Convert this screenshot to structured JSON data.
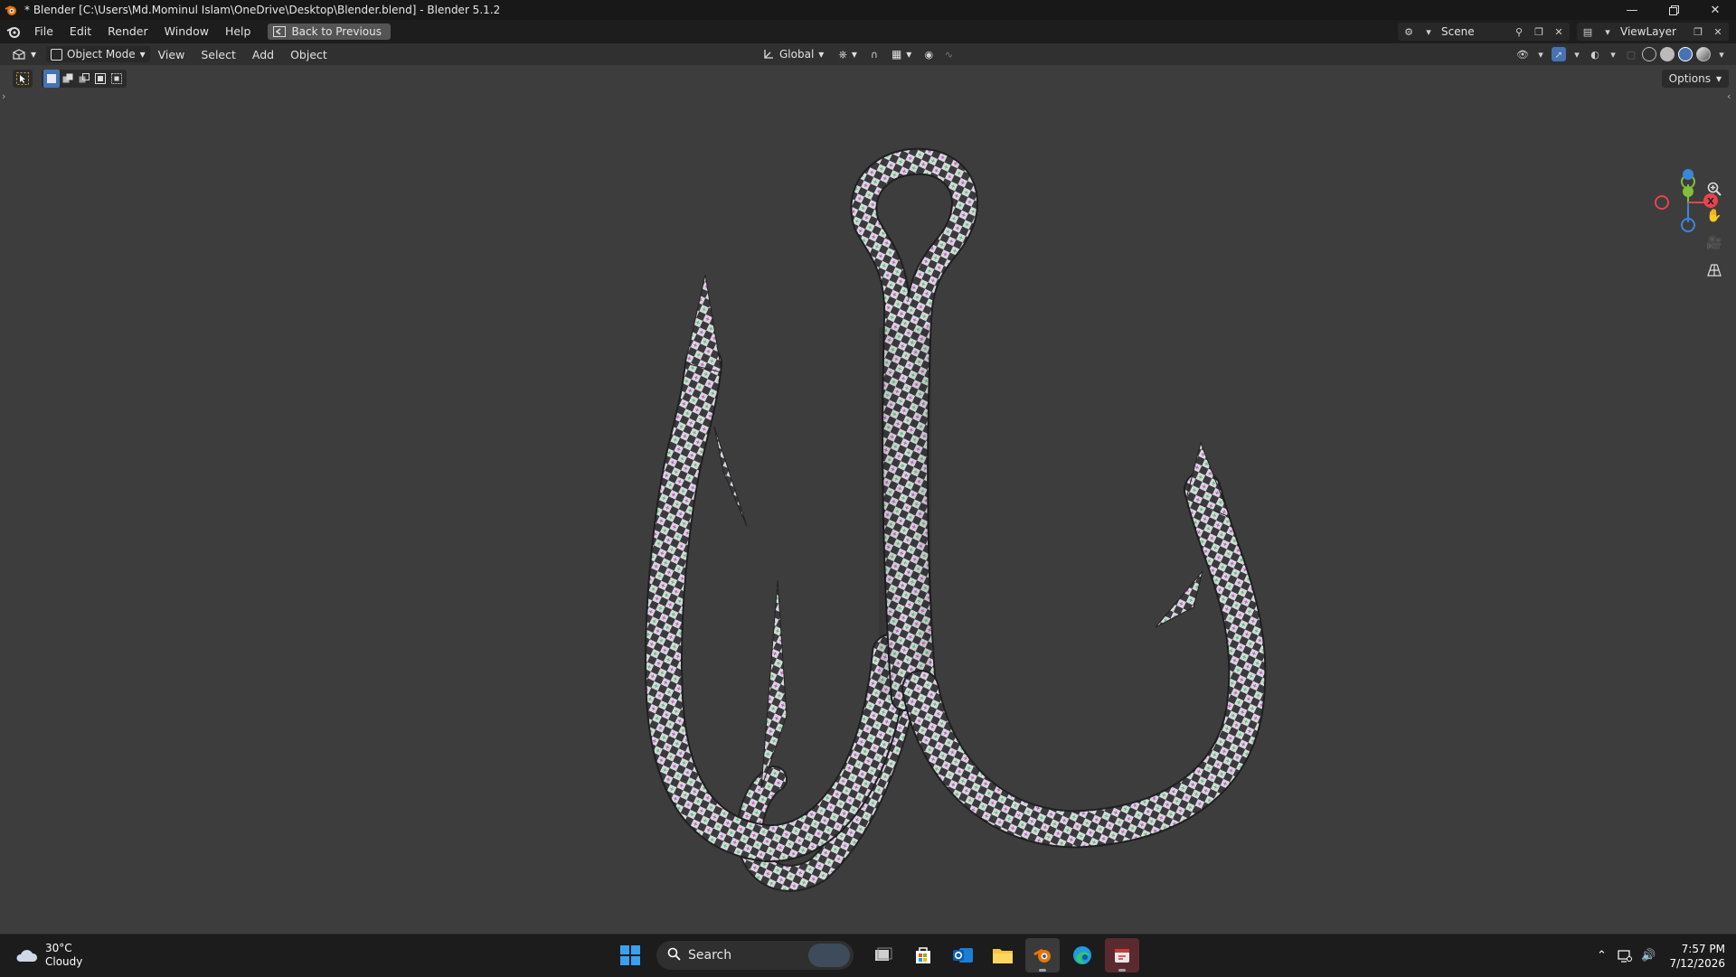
{
  "titlebar": {
    "title": "* Blender [C:\\Users\\Md.Mominul Islam\\OneDrive\\Desktop\\Blender.blend] - Blender 5.1.2",
    "minimize_icon": "minimize-icon",
    "maximize_icon": "restore-icon",
    "close_icon": "close-icon"
  },
  "topbar": {
    "menus": [
      "File",
      "Edit",
      "Render",
      "Window",
      "Help"
    ],
    "back_button": "Back to Previous",
    "scene_name": "Scene",
    "view_layer_name": "ViewLayer"
  },
  "viewport_header": {
    "mode": "Object Mode",
    "menus": [
      "View",
      "Select",
      "Add",
      "Object"
    ],
    "transform_orientation": "Global",
    "options_label": "Options"
  },
  "viewport": {
    "background_color": "#3d3d3d",
    "object": "treble fishing hook with UV checker texture",
    "axis_gizmo": {
      "x_label": "X",
      "x_color": "#e8434f",
      "y_color": "#7fbf3a",
      "z_color": "#3b86d8"
    }
  },
  "taskbar": {
    "weather_temp": "30°C",
    "weather_desc": "Cloudy",
    "search_placeholder": "Search",
    "time": "7:57 PM",
    "date": "7/12/2026"
  }
}
